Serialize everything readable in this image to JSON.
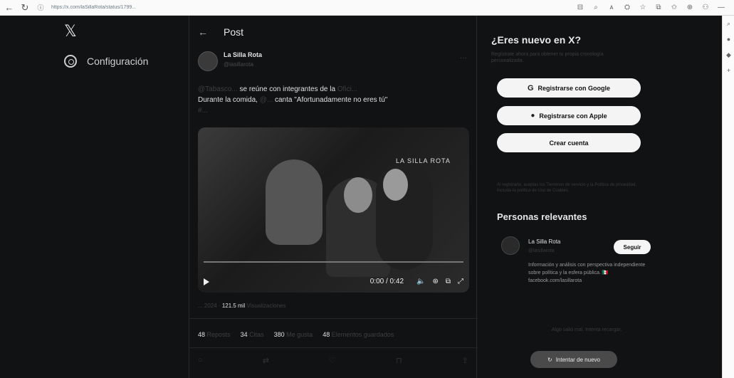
{
  "browser": {
    "url": "https://x.com/laSillaRota/status/1799...",
    "extensions": [
      "translate-icon",
      "zoom-icon",
      "read-icon",
      "ext-icon",
      "star-icon",
      "split-icon",
      "favorites-icon",
      "collections-icon",
      "profile-icon",
      "more-icon"
    ]
  },
  "sidebar": {
    "logo": "𝕏",
    "items": [
      {
        "label": "Configuración",
        "icon": "gear-icon"
      }
    ]
  },
  "post": {
    "back_label": "←",
    "title": "Post",
    "author_name": "La Silla Rota",
    "author_handle": "@lasillarota",
    "more": "···",
    "text_line1_a": "@Tabasco...",
    "text_line1_b": " se reúne con integrantes de la ",
    "text_line1_c": "Ofici...",
    "text_line2_a": "Durante la comida, ",
    "text_line2_b": "@...",
    "text_line2_c": " canta \"Afortunadamente no eres tú\"",
    "text_line3": "#...",
    "video": {
      "watermark": "LA SILLA ROTA",
      "time": "0:00 / 0:42"
    },
    "meta_date": "... 2024 ·",
    "views_value": "121.5 mil",
    "views_label": " Visualizaciones",
    "stats": [
      {
        "value": "48",
        "label": "Reposts"
      },
      {
        "value": "34",
        "label": "Citas"
      },
      {
        "value": "380",
        "label": "Me gusta"
      },
      {
        "value": "48",
        "label": "Elementos guardados"
      }
    ]
  },
  "right": {
    "new_title": "¿Eres nuevo en X?",
    "new_sub": "Regístrate ahora para obtener tu propia cronología personalizada.",
    "google_label": "Registrarse con Google",
    "apple_label": "Registrarse con Apple",
    "create_label": "Crear cuenta",
    "fine_print": "Al registrarte, aceptas los Términos de servicio y la Política de privacidad, incluida la política de Uso de Cookies.",
    "relevant_title": "Personas relevantes",
    "relevant_name": "La Silla Rota",
    "relevant_handle": "@lasillarota",
    "follow_label": "Seguir",
    "relevant_bio": "Información y análisis con perspectiva independiente sobre política y la esfera pública. 🇲🇽 facebook.com/lasillarota",
    "retry_message": "Algo salió mal. Intenta recargar.",
    "retry_label": "Intentar de nuevo"
  }
}
